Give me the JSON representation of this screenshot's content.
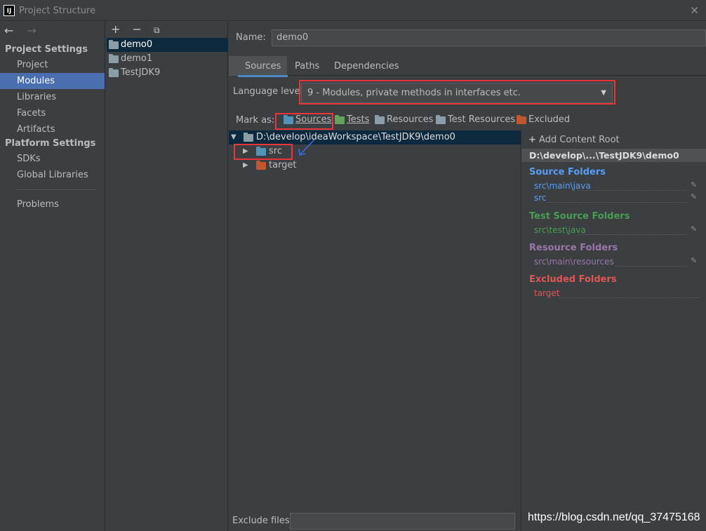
{
  "window": {
    "title": "Project Structure",
    "app_icon_text": "IJ",
    "close_icon": "close-icon"
  },
  "nav": {
    "back_icon": "arrow-left-icon",
    "forward_icon": "arrow-right-icon",
    "sections": {
      "project_settings": "Project Settings",
      "platform_settings": "Platform Settings"
    },
    "items": {
      "project": "Project",
      "modules": "Modules",
      "libraries": "Libraries",
      "facets": "Facets",
      "artifacts": "Artifacts",
      "sdks": "SDKs",
      "global_libraries": "Global Libraries",
      "problems": "Problems"
    },
    "selected": "Modules"
  },
  "modules_panel": {
    "toolbar": {
      "add": "+",
      "remove": "−",
      "copy": "copy-icon"
    },
    "items": [
      "demo0",
      "demo1",
      "TestJDK9"
    ],
    "selected": "demo0"
  },
  "main": {
    "name_label": "Name:",
    "name_value": "demo0",
    "tabs": [
      "Sources",
      "Paths",
      "Dependencies"
    ],
    "active_tab": "Sources",
    "language_level_label": "Language level:",
    "language_level_value": "9 - Modules, private methods in interfaces etc.",
    "mark_as_label": "Mark as:",
    "mark_as": {
      "sources": "Sources",
      "tests": "Tests",
      "resources": "Resources",
      "test_resources": "Test Resources",
      "excluded": "Excluded"
    },
    "tree": {
      "root": "D:\\develop\\ideaWorkspace\\TestJDK9\\demo0",
      "children": [
        "src",
        "target"
      ]
    },
    "exclude_files_label": "Exclude files:",
    "exclude_files_value": ""
  },
  "content_root": {
    "add_label": "Add Content Root",
    "path": "D:\\develop\\...\\TestJDK9\\demo0",
    "source_folders_title": "Source Folders",
    "source_folders": [
      "src\\main\\java",
      "src"
    ],
    "test_source_folders_title": "Test Source Folders",
    "test_source_folders": [
      "src\\test\\java"
    ],
    "resource_folders_title": "Resource Folders",
    "resource_folders": [
      "src\\main\\resources"
    ],
    "excluded_folders_title": "Excluded Folders",
    "excluded_folders": [
      "target"
    ]
  },
  "watermark": "https://blog.csdn.net/qq_37475168",
  "colors": {
    "selection": "#4b6eaf",
    "tree_selection": "#0d293e",
    "sources": "#589df6",
    "tests": "#499c54",
    "resources": "#9876aa",
    "excluded": "#e05555",
    "highlight_box": "#e8353a",
    "arrow": "#3d6be5"
  }
}
